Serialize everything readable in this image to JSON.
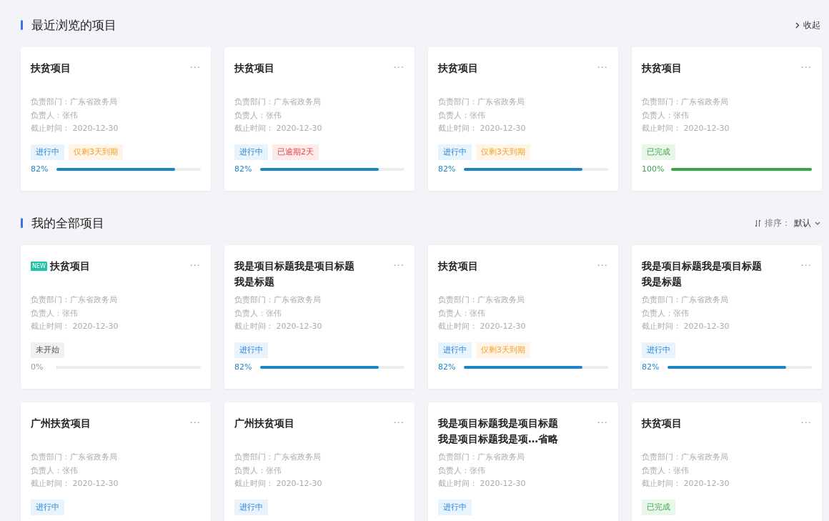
{
  "sections": [
    {
      "title": "最近浏览的项目",
      "action": {
        "kind": "collapse",
        "label": "收起"
      },
      "cards": [
        {
          "title": "扶贫项目",
          "new": false,
          "more": "···",
          "info": [
            "负责部门：广东省政务局",
            "负责人：张伟",
            "截止时间： 2020-12-30"
          ],
          "tags": [
            {
              "kind": "active",
              "label": "进行中"
            },
            {
              "kind": "warning",
              "label": "仅剩3天到期"
            }
          ],
          "progress": {
            "label": "82%",
            "level": 0.82
          }
        },
        {
          "title": "扶贫项目",
          "new": false,
          "more": "···",
          "info": [
            "负责部门：广东省政务局",
            "负责人：张伟",
            "截止时间： 2020-12-30"
          ],
          "tags": [
            {
              "kind": "active",
              "label": "进行中"
            },
            {
              "kind": "overdue",
              "label": "已逾期2天"
            }
          ],
          "progress": {
            "label": "82%",
            "level": 0.82
          }
        },
        {
          "title": "扶贫项目",
          "new": false,
          "more": "···",
          "info": [
            "负责部门：广东省政务局",
            "负责人：张伟",
            "截止时间： 2020-12-30"
          ],
          "tags": [
            {
              "kind": "active",
              "label": "进行中"
            },
            {
              "kind": "warning",
              "label": "仅剩3天到期"
            }
          ],
          "progress": {
            "label": "82%",
            "level": 0.82
          }
        },
        {
          "title": "扶贫项目",
          "new": false,
          "more": "···",
          "info": [
            "负责部门：广东省政务局",
            "负责人：张伟",
            "截止时间： 2020-12-30"
          ],
          "tags": [
            {
              "kind": "done",
              "label": "已完成"
            }
          ],
          "progress": {
            "label": "100%",
            "level": 1
          }
        }
      ]
    },
    {
      "title": "我的全部项目",
      "action": {
        "kind": "sort",
        "prefix": "排序：",
        "label": "默认"
      },
      "cards": [
        {
          "title": "扶贫项目",
          "new": true,
          "badge": "NEW",
          "more": "···",
          "info": [
            "负责部门：广东省政务局",
            "负责人：张伟",
            "截止时间： 2020-12-30"
          ],
          "tags": [
            {
              "kind": "idle",
              "label": "未开始"
            }
          ],
          "progress": {
            "label": "0%",
            "level": 0
          }
        },
        {
          "title": "我是项目标题我是项目标题我是标题",
          "new": false,
          "more": "···",
          "info": [
            "负责部门：广东省政务局",
            "负责人：张伟",
            "截止时间： 2020-12-30"
          ],
          "tags": [
            {
              "kind": "active",
              "label": "进行中"
            }
          ],
          "progress": {
            "label": "82%",
            "level": 0.82
          }
        },
        {
          "title": "扶贫项目",
          "new": false,
          "more": "···",
          "info": [
            "负责部门：广东省政务局",
            "负责人：张伟",
            "截止时间： 2020-12-30"
          ],
          "tags": [
            {
              "kind": "active",
              "label": "进行中"
            },
            {
              "kind": "warning",
              "label": "仅剩3天到期"
            }
          ],
          "progress": {
            "label": "82%",
            "level": 0.82
          }
        },
        {
          "title": "我是项目标题我是项目标题我是标题",
          "new": false,
          "more": "···",
          "info": [
            "负责部门：广东省政务局",
            "负责人：张伟",
            "截止时间： 2020-12-30"
          ],
          "tags": [
            {
              "kind": "active",
              "label": "进行中"
            }
          ],
          "progress": {
            "label": "82%",
            "level": 0.82
          }
        },
        {
          "title": "广州扶贫项目",
          "new": false,
          "more": "···",
          "info": [
            "负责部门：广东省政务局",
            "负责人：张伟",
            "截止时间： 2020-12-30"
          ],
          "tags": [
            {
              "kind": "active",
              "label": "进行中"
            }
          ]
        },
        {
          "title": "广州扶贫项目",
          "new": false,
          "more": "···",
          "info": [
            "负责部门：广东省政务局",
            "负责人：张伟",
            "截止时间： 2020-12-30"
          ],
          "tags": [
            {
              "kind": "active",
              "label": "进行中"
            }
          ]
        },
        {
          "title": "我是项目标题我是项目标题我是项目标题我是项…省略",
          "new": false,
          "more": "···",
          "info": [
            "负责部门：广东省政务局",
            "负责人：张伟",
            "截止时间： 2020-12-30"
          ],
          "tags": [
            {
              "kind": "active",
              "label": "进行中"
            }
          ]
        },
        {
          "title": "扶贫项目",
          "new": false,
          "more": "···",
          "info": [
            "负责部门：广东省政务局",
            "负责人：张伟",
            "截止时间： 2020-12-30"
          ],
          "tags": [
            {
              "kind": "done",
              "label": "已完成"
            }
          ]
        }
      ]
    }
  ]
}
